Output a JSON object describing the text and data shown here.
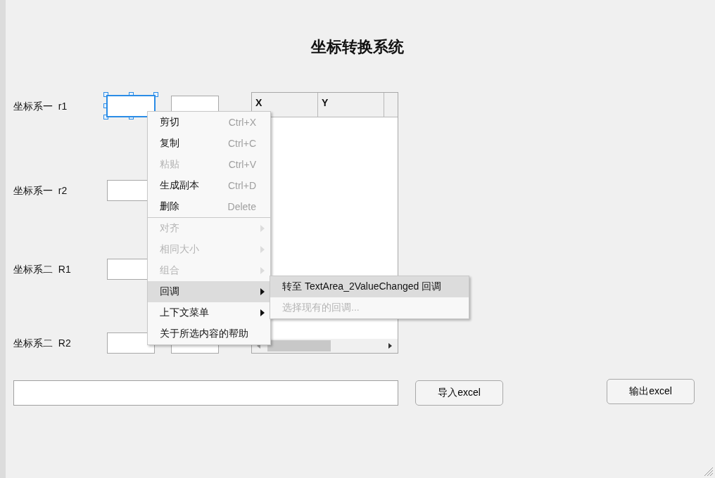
{
  "title": "坐标转换系统",
  "rows": [
    {
      "label": "坐标系一",
      "suffix": "r1",
      "selected": true
    },
    {
      "label": "坐标系一",
      "suffix": "r2",
      "selected": false
    },
    {
      "label": "坐标系二",
      "suffix": "R1",
      "selected": false
    },
    {
      "label": "坐标系二",
      "suffix": "R2",
      "selected": false
    }
  ],
  "table": {
    "columns": [
      "X",
      "Y"
    ]
  },
  "buttons": [
    "导入excel",
    "输出excel"
  ],
  "context_menu": {
    "groups": [
      [
        {
          "label": "剪切",
          "shortcut": "Ctrl+X",
          "disabled": false,
          "has_submenu": false,
          "selected": false
        },
        {
          "label": "复制",
          "shortcut": "Ctrl+C",
          "disabled": false,
          "has_submenu": false,
          "selected": false
        },
        {
          "label": "粘贴",
          "shortcut": "Ctrl+V",
          "disabled": true,
          "has_submenu": false,
          "selected": false
        },
        {
          "label": "生成副本",
          "shortcut": "Ctrl+D",
          "disabled": false,
          "has_submenu": false,
          "selected": false
        },
        {
          "label": "删除",
          "shortcut": "Delete",
          "disabled": false,
          "has_submenu": false,
          "selected": false
        }
      ],
      [
        {
          "label": "对齐",
          "disabled": true,
          "has_submenu": true,
          "selected": false
        },
        {
          "label": "相同大小",
          "disabled": true,
          "has_submenu": true,
          "selected": false
        },
        {
          "label": "组合",
          "disabled": true,
          "has_submenu": true,
          "selected": false
        },
        {
          "label": "回调",
          "disabled": false,
          "has_submenu": true,
          "selected": true
        },
        {
          "label": "上下文菜单",
          "disabled": false,
          "has_submenu": true,
          "selected": false
        },
        {
          "label": "关于所选内容的帮助",
          "disabled": false,
          "has_submenu": false,
          "selected": false
        }
      ]
    ],
    "submenu": [
      {
        "label": "转至 TextArea_2ValueChanged 回调",
        "disabled": false,
        "selected": true
      },
      {
        "label": "选择现有的回调...",
        "disabled": true,
        "selected": false
      }
    ]
  }
}
